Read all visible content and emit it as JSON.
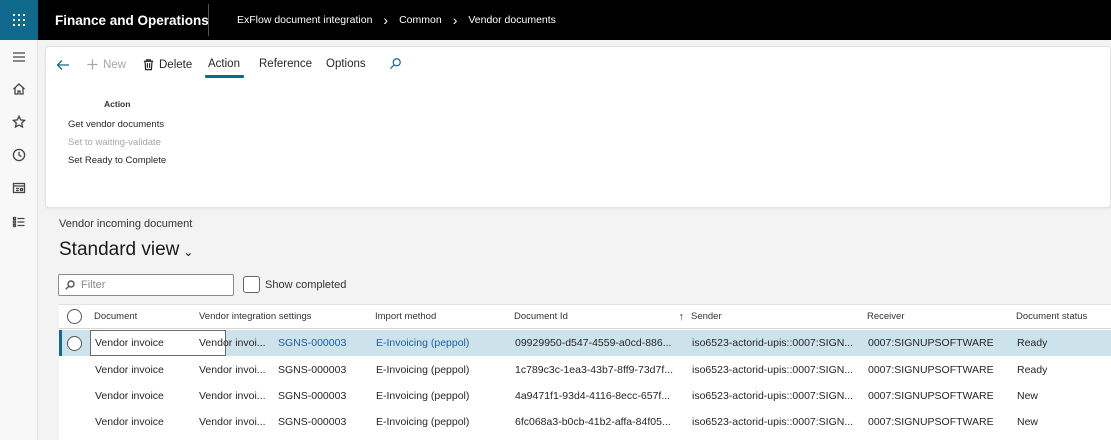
{
  "app": {
    "title": "Finance and Operations"
  },
  "breadcrumbs": [
    "ExFlow document integration",
    "Common",
    "Vendor documents"
  ],
  "toolbar": {
    "new_label": "New",
    "delete_label": "Delete",
    "tabs": [
      "Action",
      "Reference",
      "Options"
    ],
    "active_tab": "Action"
  },
  "action_group": {
    "title": "Action",
    "items": [
      {
        "label": "Get vendor documents",
        "enabled": true
      },
      {
        "label": "Set to waiting-validate",
        "enabled": false
      },
      {
        "label": "Set Ready to Complete",
        "enabled": true
      }
    ]
  },
  "page": {
    "caption": "Vendor incoming document",
    "view_name": "Standard view"
  },
  "filter": {
    "placeholder": "Filter",
    "value": ""
  },
  "show_completed": {
    "label": "Show completed",
    "checked": false
  },
  "grid": {
    "columns": [
      "Document",
      "Vendor integration settings",
      "Import method",
      "Document Id",
      "Sender",
      "Receiver",
      "Document status"
    ],
    "sorted_column": "Document Id",
    "sort_direction": "ascending",
    "rows": [
      {
        "document": "Vendor invoice",
        "vis_prefix": "Vendor invoi...",
        "vis_id": "SGNS-000003",
        "import_method": "E-Invoicing (peppol)",
        "document_id": "09929950-d547-4559-a0cd-886...",
        "sender": "iso6523-actorid-upis::0007:SIGN...",
        "receiver": "0007:SIGNUPSOFTWARE",
        "status": "Ready",
        "selected": true
      },
      {
        "document": "Vendor invoice",
        "vis_prefix": "Vendor invoi...",
        "vis_id": "SGNS-000003",
        "import_method": "E-Invoicing (peppol)",
        "document_id": "1c789c3c-1ea3-43b7-8ff9-73d7f...",
        "sender": "iso6523-actorid-upis::0007:SIGN...",
        "receiver": "0007:SIGNUPSOFTWARE",
        "status": "Ready",
        "selected": false
      },
      {
        "document": "Vendor invoice",
        "vis_prefix": "Vendor invoi...",
        "vis_id": "SGNS-000003",
        "import_method": "E-Invoicing (peppol)",
        "document_id": "4a9471f1-93d4-4116-8ecc-657f...",
        "sender": "iso6523-actorid-upis::0007:SIGN...",
        "receiver": "0007:SIGNUPSOFTWARE",
        "status": "New",
        "selected": false
      },
      {
        "document": "Vendor invoice",
        "vis_prefix": "Vendor invoi...",
        "vis_id": "SGNS-000003",
        "import_method": "E-Invoicing (peppol)",
        "document_id": "6fc068a3-b0cb-41b2-affa-84f05...",
        "sender": "iso6523-actorid-upis::0007:SIGN...",
        "receiver": "0007:SIGNUPSOFTWARE",
        "status": "New",
        "selected": false
      }
    ]
  },
  "icons": {
    "app_launcher": "waffle-icon",
    "rail": [
      "hamburger-icon",
      "home-icon",
      "star-icon",
      "clock-icon",
      "workspace-icon",
      "list-icon"
    ],
    "toolbar": [
      "back-arrow-icon",
      "plus-icon",
      "trash-icon",
      "search-icon"
    ]
  },
  "colors": {
    "brand": "#0f6a8e",
    "link": "#1d5fa8",
    "selected_row": "#cde3ec"
  }
}
